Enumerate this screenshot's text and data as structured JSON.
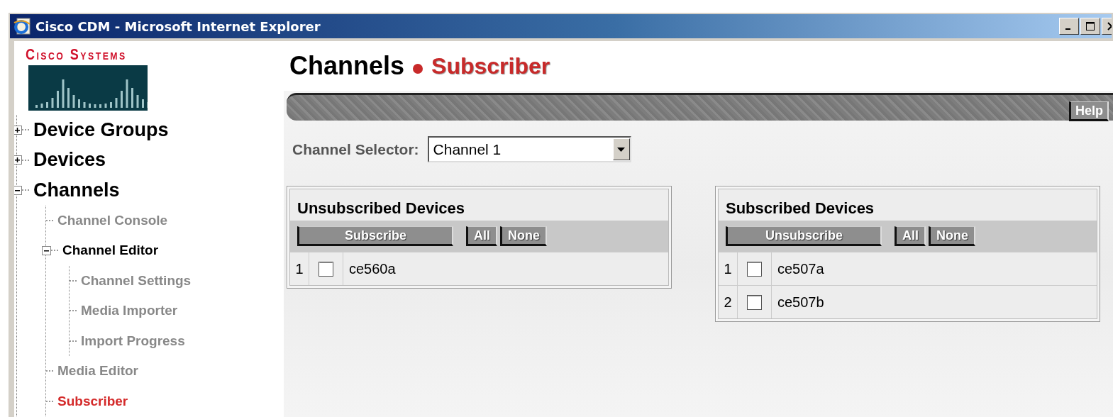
{
  "window": {
    "title": "Cisco CDM - Microsoft Internet Explorer"
  },
  "sidebar": {
    "logo": "Cisco Systems",
    "tree": [
      {
        "label": "Device Groups",
        "expanded": false,
        "selected": false
      },
      {
        "label": "Devices",
        "expanded": false,
        "selected": false
      },
      {
        "label": "Channels",
        "expanded": true,
        "selected": false,
        "children": [
          {
            "label": "Channel Console",
            "selected": false
          },
          {
            "label": "Channel Editor",
            "expanded": true,
            "selected": false,
            "children": [
              {
                "label": "Channel Settings",
                "selected": false
              },
              {
                "label": "Media Importer",
                "selected": false
              },
              {
                "label": "Import Progress",
                "selected": false
              }
            ]
          },
          {
            "label": "Media Editor",
            "selected": false
          },
          {
            "label": "Subscriber",
            "selected": true
          }
        ]
      }
    ]
  },
  "header": {
    "section": "Channels",
    "page": "Subscriber"
  },
  "toolbar": {
    "buttons": [
      "Help"
    ]
  },
  "channel_selector": {
    "label": "Channel Selector:",
    "value": "Channel 1"
  },
  "panels": [
    {
      "title": "Unsubscribed Devices",
      "action": "Subscribe",
      "select_all": "All",
      "select_none": "None",
      "rows": [
        {
          "index": "1",
          "name": "ce560a",
          "checked": false
        }
      ]
    },
    {
      "title": "Subscribed Devices",
      "action": "Unsubscribe",
      "select_all": "All",
      "select_none": "None",
      "rows": [
        {
          "index": "1",
          "name": "ce507a",
          "checked": false
        },
        {
          "index": "2",
          "name": "ce507b",
          "checked": false
        }
      ]
    }
  ]
}
